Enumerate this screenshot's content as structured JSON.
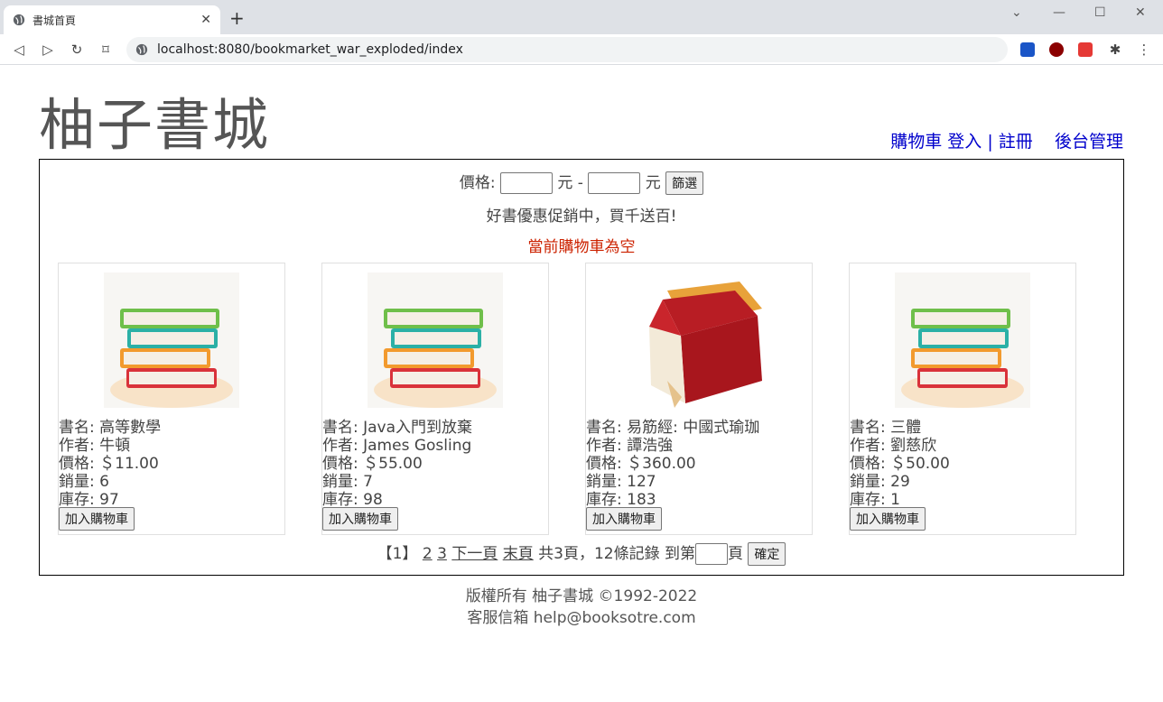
{
  "browser": {
    "tab_title": "書城首頁",
    "url": "localhost:8080/bookmarket_war_exploded/index"
  },
  "site": {
    "title": "柚子書城"
  },
  "nav": {
    "cart": "購物車",
    "login": "登入",
    "sep": "|",
    "register": "註冊",
    "admin": "後台管理"
  },
  "filter": {
    "label": "價格:",
    "unit": "元",
    "dash": "-",
    "button": "篩選"
  },
  "promo": "好書優惠促銷中，買千送百!",
  "cart_status": "當前購物車為空",
  "books": [
    {
      "name": "書名: 高等數學",
      "author": "作者: 牛頓",
      "price": "價格: ＄11.00",
      "sales": "銷量: 6",
      "stock": "庫存: 97",
      "button": "加入購物車",
      "image": "stacked-books-icon"
    },
    {
      "name": "書名: Java入門到放棄",
      "author": "作者: James Gosling",
      "price": "價格: ＄55.00",
      "sales": "銷量: 7",
      "stock": "庫存: 98",
      "button": "加入購物車",
      "image": "stacked-books-icon"
    },
    {
      "name": "書名: 易筋經: 中國式瑜珈",
      "author": "作者: 譚浩強",
      "price": "價格: ＄360.00",
      "sales": "銷量: 127",
      "stock": "庫存: 183",
      "button": "加入購物車",
      "image": "red-book-icon"
    },
    {
      "name": "書名: 三體",
      "author": "作者: 劉慈欣",
      "price": "價格: ＄50.00",
      "sales": "銷量: 29",
      "stock": "庫存: 1",
      "button": "加入購物車",
      "image": "stacked-books-icon"
    }
  ],
  "pager": {
    "current": "【1】",
    "page2": "2",
    "page3": "3",
    "next": "下一頁",
    "last": "末頁",
    "summary": "共3頁，12條記錄 到第",
    "page_suffix": "頁",
    "confirm": "確定"
  },
  "footer": {
    "line1": "版權所有 柚子書城 ©1992-2022",
    "line2": "客服信箱 help@booksotre.com"
  }
}
